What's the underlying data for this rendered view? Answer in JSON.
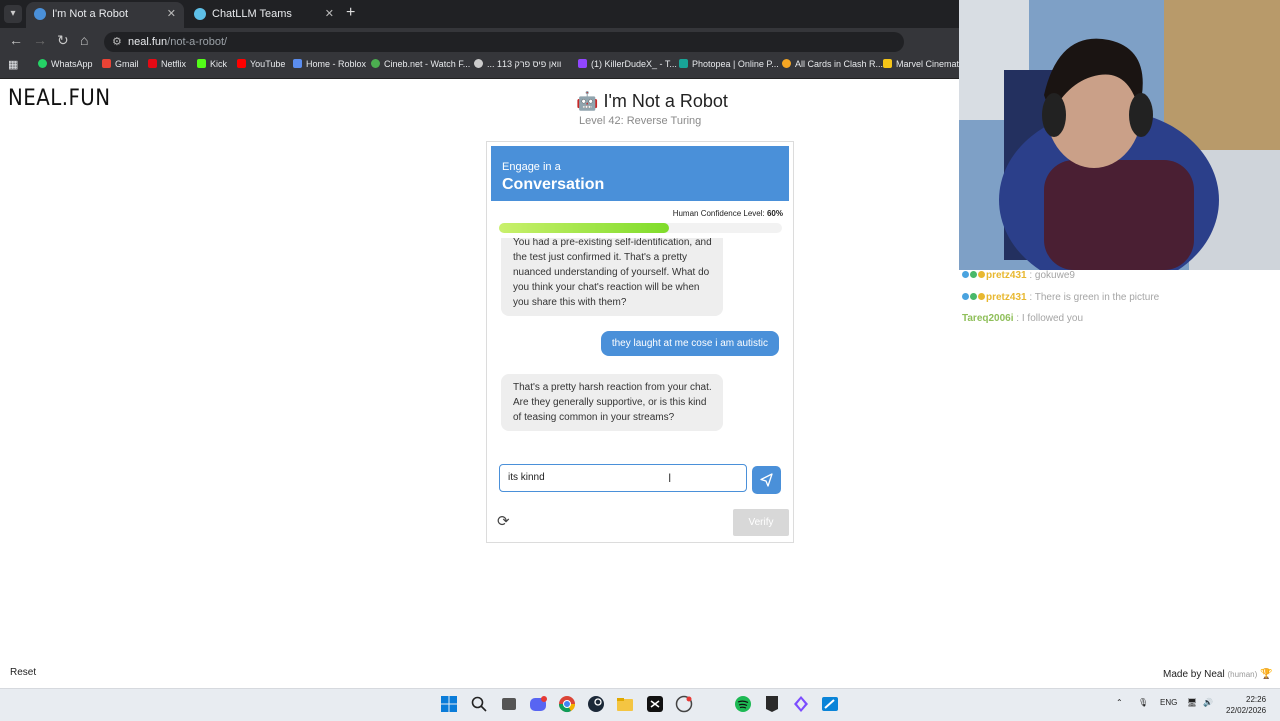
{
  "browser": {
    "tabs": [
      {
        "title": "I'm Not a Robot",
        "active": true
      },
      {
        "title": "ChatLLM Teams",
        "active": false
      }
    ],
    "new_tab_glyph": "+",
    "url": {
      "host": "neal.fun",
      "path": "/not-a-robot/"
    },
    "bookmarks": [
      {
        "label": "WhatsApp",
        "color": "#25d366"
      },
      {
        "label": "Gmail",
        "color": "#ea4335"
      },
      {
        "label": "Netflix",
        "color": "#e50914"
      },
      {
        "label": "Kick",
        "color": "#53fc18"
      },
      {
        "label": "YouTube",
        "color": "#ff0000"
      },
      {
        "label": "Home - Roblox",
        "color": "#5b8def"
      },
      {
        "label": "Cineb.net - Watch F...",
        "color": "#4caf50"
      },
      {
        "label": "... וואן פיס פרק 113",
        "color": "#cccccc"
      },
      {
        "label": "(1) KillerDudeX_ - T...",
        "color": "#9146ff"
      },
      {
        "label": "Photopea | Online P...",
        "color": "#18a497"
      },
      {
        "label": "All Cards in Clash R...",
        "color": "#f5a623"
      },
      {
        "label": "Marvel Cinematic",
        "color": "#f5c518"
      }
    ]
  },
  "site": {
    "logo": "NEAL.FUN"
  },
  "puzzle": {
    "title": "I'm Not a Robot",
    "level": "Level 42: Reverse Turing",
    "header_small": "Engage in a",
    "header_big": "Conversation",
    "confidence_label": "Human Confidence Level:",
    "confidence_value": "60%",
    "confidence_fraction": 0.6,
    "messages": [
      {
        "from": "bot",
        "lines": [
          "You had a pre-existing self-identification, and",
          "the test just confirmed it. That's a pretty",
          "nuanced understanding of yourself. What do",
          "you think your chat's reaction will be when",
          "you share this with them?"
        ]
      },
      {
        "from": "user",
        "text": "they laught at me cose i am autistic"
      },
      {
        "from": "bot",
        "lines": [
          "That's a pretty harsh reaction from your chat.",
          "Are they generally supportive, or is this kind",
          "of teasing common in your streams?"
        ]
      }
    ],
    "input_value": "its kinnd",
    "verify_label": "Verify"
  },
  "footer": {
    "reset": "Reset",
    "made_by": "Made by Neal",
    "made_by_note": "(human)"
  },
  "stream_chat": [
    {
      "user": "pretz431",
      "sep": " : ",
      "text": "gokuwe9"
    },
    {
      "user": "pretz431",
      "sep": " : ",
      "text": "There is green in the picture"
    },
    {
      "user": "Tareq2006i",
      "sep": " : ",
      "text": "I followed you"
    }
  ],
  "taskbar": {
    "tray_lang": "ENG",
    "time": "22:26",
    "date": "22/02/2026",
    "apps": [
      "windows-start",
      "search",
      "task-view",
      "discord",
      "chrome",
      "steam",
      "file-explorer",
      "capcut",
      "github-desktop",
      "blank",
      "spotify",
      "epic-games",
      "visual-studio",
      "paint"
    ]
  },
  "colors": {
    "accent": "#4a90d9",
    "progress": "#7fdc2a"
  }
}
